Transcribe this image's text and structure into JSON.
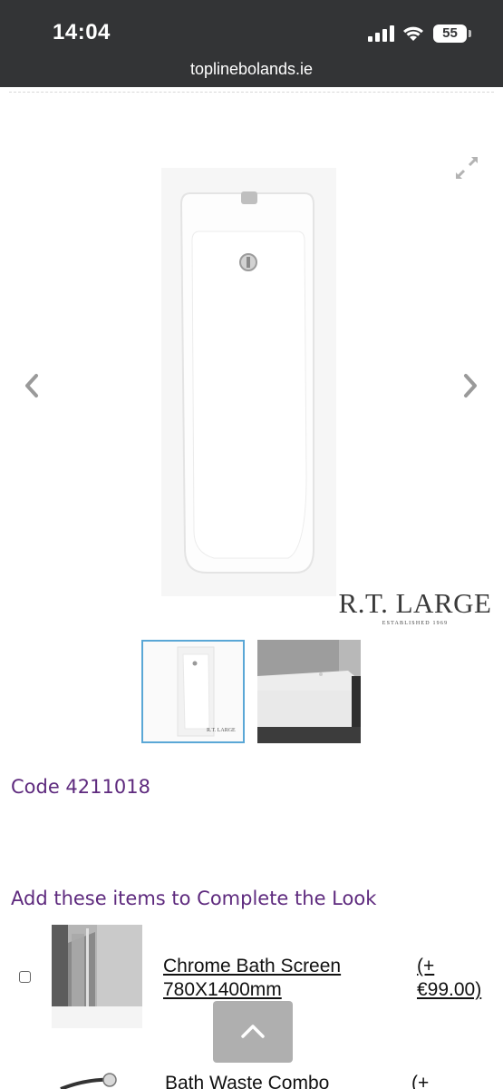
{
  "status_bar": {
    "time": "14:04",
    "battery": "55",
    "url": "toplinebolands.ie",
    "icons": [
      "signal-icon",
      "wifi-icon",
      "battery-icon"
    ]
  },
  "gallery": {
    "brand": {
      "name": "R.T. LARGE",
      "tagline": "ESTABLISHED 1969"
    },
    "thumbnail_label": "R.T. LARGE",
    "icons": [
      "expand-icon",
      "chevron-left-icon",
      "chevron-right-icon"
    ]
  },
  "product": {
    "code": "Code 4211018"
  },
  "complete_the_look": {
    "title": "Add these items to Complete the Look",
    "items": [
      {
        "name_line1": "Chrome Bath Screen",
        "name_line2": "780X1400mm",
        "price_line1": "(+",
        "price_line2": "€99.00)"
      },
      {
        "name_line1": "Bath Waste Combo",
        "price_line1": "(+"
      }
    ]
  },
  "back_to_top": {
    "icon": "chevron-up-icon"
  },
  "colors": {
    "status_bar_bg": "#333436",
    "accent_purple": "#5e2a7e",
    "thumb_selected_border": "#5aa7d6",
    "back_to_top_bg": "#ababab"
  }
}
